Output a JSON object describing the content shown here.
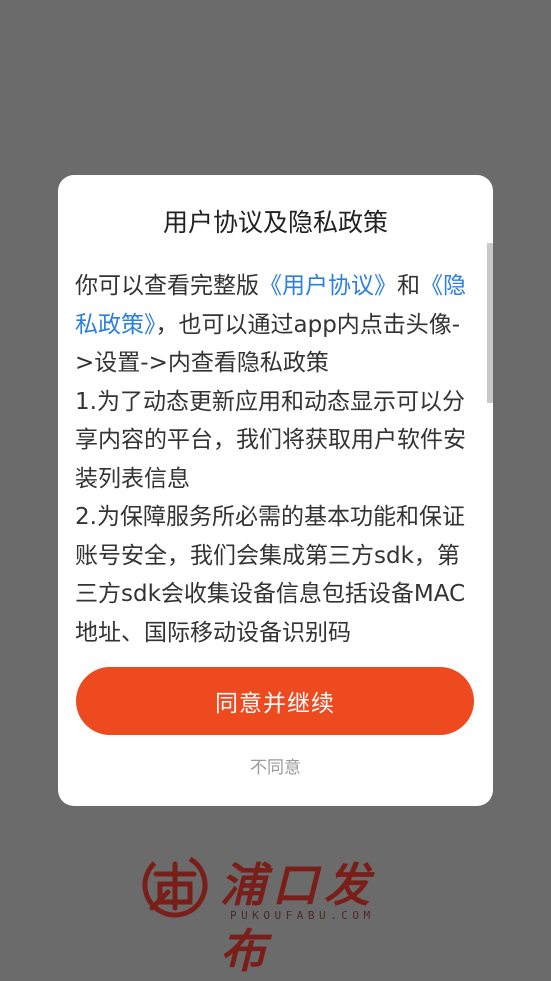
{
  "dialog": {
    "title": "用户协议及隐私政策",
    "intro_prefix": "你可以查看完整版",
    "user_agreement_link": "《用户协议》",
    "and_text": "和",
    "privacy_policy_link": "《隐私政策》",
    "intro_suffix": "，也可以通过app内点击头像->设置->内查看隐私政策",
    "paragraph_1": "1.为了动态更新应用和动态显示可以分享内容的平台，我们将获取用户软件安装列表信息",
    "paragraph_2": "2.为保障服务所必需的基本功能和保证账号安全，我们会集成第三方sdk，第三方sdk会收集设备信息包括设备MAC地址、国际移动设备识别码",
    "agree_button": "同意并继续",
    "disagree_button": "不同意"
  },
  "brand": {
    "name": "浦口发布",
    "domain_text": "PUKOUFABU.COM",
    "logo_icon": "pukou-seal-icon"
  },
  "colors": {
    "overlay": "#6b6b6b",
    "accent": "#ee4a1f",
    "link": "#2a7fe0",
    "brand": "#7a1e1a"
  }
}
